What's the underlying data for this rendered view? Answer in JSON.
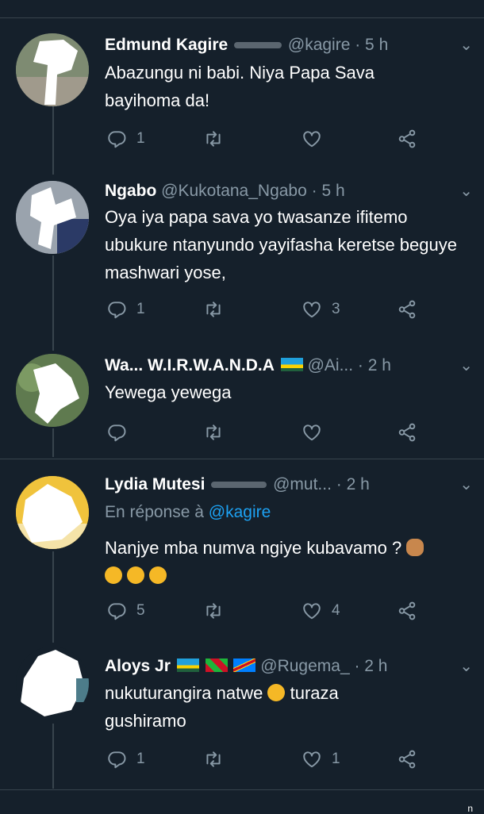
{
  "tweets": [
    {
      "name": "Edmund Kagire",
      "handle": "@kagire",
      "time": "· 5 h",
      "reply_to_prefix": "",
      "reply_to_handle": "",
      "text": "Abazungu ni babi. Niya Papa Sava bayihoma da!",
      "emoji_line": "",
      "replies": "1",
      "retweets": "",
      "likes": ""
    },
    {
      "name": "Ngabo",
      "handle": "@Kukotana_Ngabo",
      "time": "· 5 h",
      "reply_to_prefix": "",
      "reply_to_handle": "",
      "text": "Oya iya papa sava yo twasanze ifitemo ubukure ntanyundo yayifasha keretse beguye mashwari yose,",
      "emoji_line": "",
      "replies": "1",
      "retweets": "",
      "likes": "3"
    },
    {
      "name": "Wa... W.I.R.W.A.N.D.A",
      "handle": "@Ai...",
      "time": "· 2 h",
      "reply_to_prefix": "",
      "reply_to_handle": "",
      "text": "Yewega yewega",
      "emoji_line": "",
      "replies": "",
      "retweets": "",
      "likes": ""
    },
    {
      "name": "Lydia Mutesi",
      "handle": "@mut...",
      "time": "· 2 h",
      "reply_to_prefix": "En réponse à",
      "reply_to_handle": "@kagire",
      "text": "Nanjye mba numva ngiye kubavamo ?",
      "emoji_line": "",
      "replies": "5",
      "retweets": "",
      "likes": "4"
    },
    {
      "name": "Aloys Jr",
      "handle": "@Rugema_",
      "time": "· 2 h",
      "reply_to_prefix": "",
      "reply_to_handle": "",
      "text_a": "nukuturangira natwe",
      "text_b": " turaza gushiramo",
      "replies": "1",
      "retweets": "",
      "likes": "1"
    }
  ],
  "icons": {
    "reply": "reply-bubble-icon",
    "retweet": "retweet-arrows-icon",
    "like": "heart-icon",
    "share": "share-nodes-icon",
    "menu": "chevron-down-icon"
  },
  "colors": {
    "background": "#15202b",
    "muted": "#8899a6",
    "link": "#1da1f2",
    "divider": "#38444d"
  },
  "corner_text": "n"
}
